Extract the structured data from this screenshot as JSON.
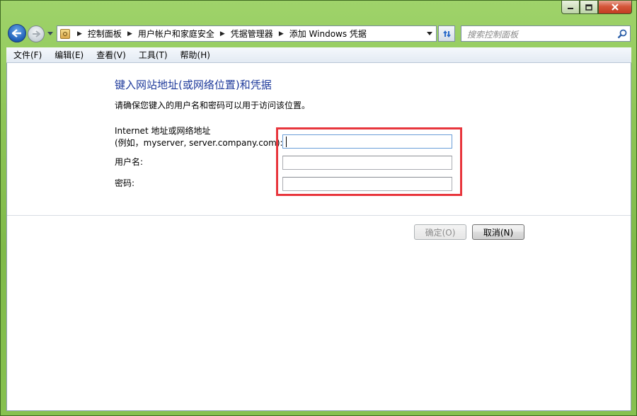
{
  "window": {
    "controls": {
      "minimize_icon": "minimize-icon",
      "maximize_icon": "maximize-icon",
      "close_icon": "close-icon"
    }
  },
  "address_bar": {
    "breadcrumbs": [
      "控制面板",
      "用户帐户和家庭安全",
      "凭据管理器",
      "添加 Windows 凭据"
    ]
  },
  "search": {
    "placeholder": "搜索控制面板"
  },
  "menu": [
    "文件(F)",
    "编辑(E)",
    "查看(V)",
    "工具(T)",
    "帮助(H)"
  ],
  "form": {
    "heading": "键入网站地址(或网络位置)和凭据",
    "description": "请确保您键入的用户名和密码可以用于访问该位置。",
    "address_label_line1": "Internet 地址或网络地址",
    "address_label_line2": "(例如，myserver, server.company.com):",
    "address_value": "",
    "username_label": "用户名:",
    "username_value": "",
    "password_label": "密码:",
    "password_value": ""
  },
  "buttons": {
    "ok": "确定(O)",
    "cancel": "取消(N)"
  },
  "colors": {
    "highlight": "#e8363d",
    "heading": "#1e3a9b",
    "titlebar": "#8cc456"
  }
}
